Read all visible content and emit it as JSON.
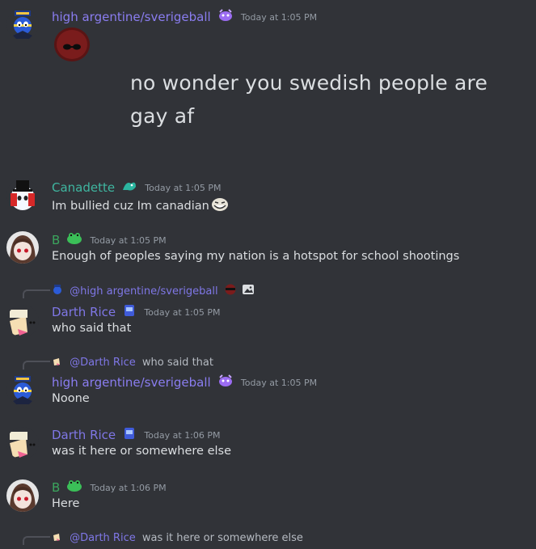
{
  "messages": [
    {
      "author": "high argentine/sverigeball",
      "time": "Today at 1:05 PM",
      "meme_line1": "no wonder you swedish people are",
      "meme_line2": "gay af",
      "avatar_icon": "swedish-countryball-avatar",
      "badge_icon": "purple-creature-badge",
      "color": "#8a7df0"
    },
    {
      "author": "Canadette",
      "time": "Today at 1:05 PM",
      "text": "Im bullied cuz Im canadian",
      "avatar_icon": "canadaball-tophat-avatar",
      "badge_icon": "teal-dragon-badge",
      "emoji_icon": "trollface-emoji",
      "color": "#3fb6a0"
    },
    {
      "author": "B",
      "time": "Today at 1:05 PM",
      "text": "Enough of peoples saying my nation is a hotspot for school shootings",
      "avatar_icon": "anime-girl-avatar",
      "badge_icon": "green-frog-badge",
      "color": "#3ba55d"
    },
    {
      "reply_to": "@high argentine/sverigeball",
      "author": "Darth Rice",
      "time": "Today at 1:05 PM",
      "text": "who said that",
      "avatar_icon": "rice-ball-avatar",
      "badge_icon": "blue-box-badge",
      "color": "#7f77e6"
    },
    {
      "reply_to": "@Darth Rice",
      "reply_text": "who said that",
      "author": "high argentine/sverigeball",
      "time": "Today at 1:05 PM",
      "text": "Noone",
      "avatar_icon": "swedish-countryball-avatar",
      "badge_icon": "purple-creature-badge",
      "color": "#8a7df0"
    },
    {
      "author": "Darth Rice",
      "time": "Today at 1:06 PM",
      "text": "was it here or somewhere else",
      "avatar_icon": "rice-ball-avatar",
      "badge_icon": "blue-box-badge",
      "color": "#7f77e6"
    },
    {
      "author": "B",
      "time": "Today at 1:06 PM",
      "text": "Here",
      "avatar_icon": "anime-girl-avatar",
      "badge_icon": "green-frog-badge",
      "color": "#3ba55d"
    },
    {
      "reply_to": "@Darth Rice",
      "reply_text": "was it here or somewhere else"
    }
  ]
}
